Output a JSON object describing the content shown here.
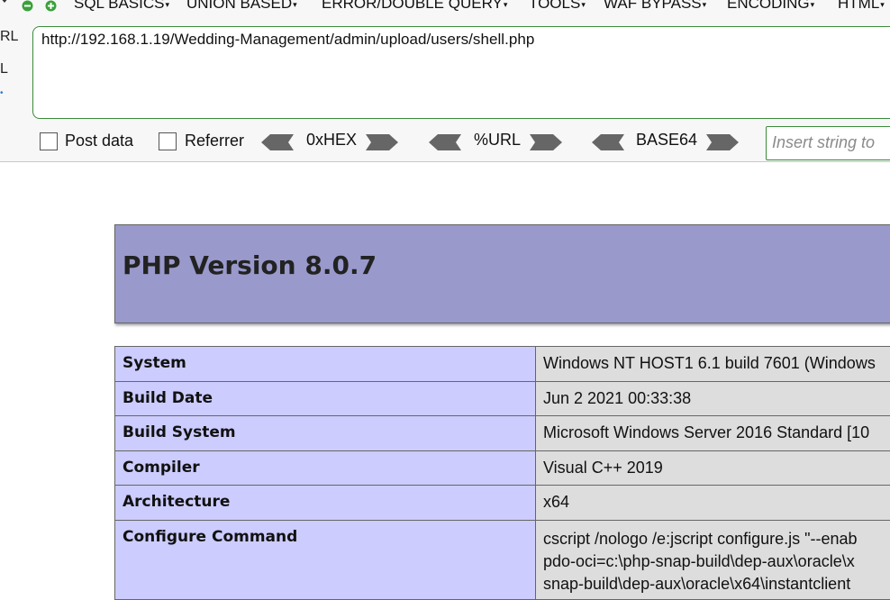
{
  "hackbar": {
    "side_labels": [
      "RL",
      "L"
    ],
    "menu": [
      {
        "label": "SQL BASICS"
      },
      {
        "label": "UNION BASED"
      },
      {
        "label": "ERROR/DOUBLE QUERY"
      },
      {
        "label": "TOOLS"
      },
      {
        "label": "WAF BYPASS"
      },
      {
        "label": "ENCODING"
      },
      {
        "label": "HTML"
      }
    ],
    "url": "http://192.168.1.19/Wedding-Management/admin/upload/users/shell.php",
    "post_data_label": "Post data",
    "referrer_label": "Referrer",
    "encoders": [
      "0xHEX",
      "%URL",
      "BASE64"
    ],
    "insert_placeholder": "Insert string to"
  },
  "phpinfo": {
    "title": "PHP Version 8.0.7",
    "rows": [
      {
        "key": "System",
        "value": "Windows NT HOST1 6.1 build 7601 (Windows"
      },
      {
        "key": "Build Date",
        "value": "Jun 2 2021 00:33:38"
      },
      {
        "key": "Build System",
        "value": "Microsoft Windows Server 2016 Standard [10"
      },
      {
        "key": "Compiler",
        "value": "Visual C++ 2019"
      },
      {
        "key": "Architecture",
        "value": "x64"
      }
    ],
    "configure": {
      "key": "Configure Command",
      "lines": [
        "cscript /nologo /e:jscript configure.js \"--enab",
        "pdo-oci=c:\\php-snap-build\\dep-aux\\oracle\\x",
        "snap-build\\dep-aux\\oracle\\x64\\instantclient"
      ]
    }
  }
}
